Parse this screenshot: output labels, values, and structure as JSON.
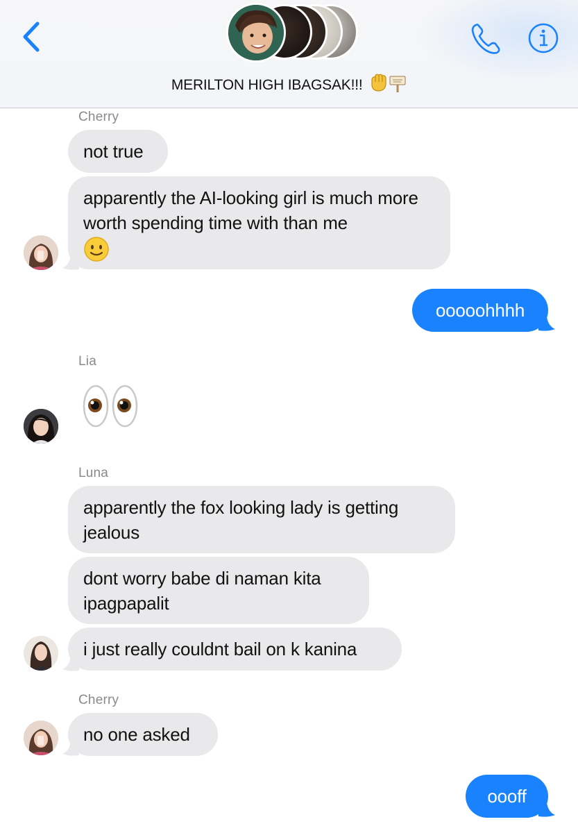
{
  "header": {
    "title": "MERILTON HIGH IBAGSAK!!!",
    "title_emoji": "✊🪧",
    "accent": "#1982fc",
    "icons": [
      "back-chevron-icon",
      "phone-icon",
      "info-icon"
    ]
  },
  "messages": [
    {
      "sender": "Cherry",
      "text": "not true"
    },
    {
      "text": "apparently the AI-looking girl is much more worth spending time with than me",
      "emoji": "slightly-smiling-face"
    },
    {
      "text": "ooooohhhh",
      "outgoing": true
    },
    {
      "sender": "Lia",
      "emoji": "eyes"
    },
    {
      "sender": "Luna",
      "text": "apparently the fox looking lady is getting jealous"
    },
    {
      "text": "dont worry babe di naman kita ipagpapalit"
    },
    {
      "text": "i just really couldnt bail on k kanina"
    },
    {
      "sender": "Cherry",
      "text": "no one asked"
    },
    {
      "text": "oooff",
      "outgoing": true
    }
  ],
  "colors": {
    "incoming_bubble": "#e9e9eb",
    "outgoing_bubble": "#1982fc",
    "sender_label": "#8a8a8e"
  }
}
